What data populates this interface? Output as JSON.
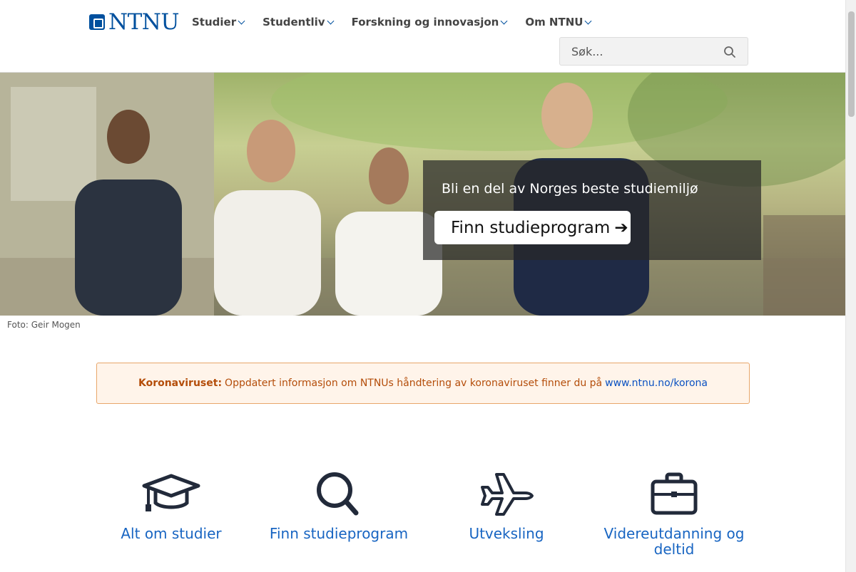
{
  "header": {
    "logo_text": "NTNU",
    "nav": [
      {
        "label": "Studier"
      },
      {
        "label": "Studentliv"
      },
      {
        "label": "Forskning og innovasjon"
      },
      {
        "label": "Om NTNU"
      }
    ],
    "search": {
      "placeholder": "Søk..."
    }
  },
  "hero": {
    "tagline": "Bli en del av Norges beste studiemiljø",
    "button_label": "Finn studieprogram",
    "caption": "Foto: Geir Mogen"
  },
  "alert": {
    "label": "Koronaviruset:",
    "text": "Oppdatert informasjon om NTNUs håndtering av koronaviruset finner du på",
    "link": "www.ntnu.no/korona"
  },
  "tiles": [
    {
      "label": "Alt om studier",
      "icon": "graduation-cap-icon"
    },
    {
      "label": "Finn studieprogram",
      "icon": "search-icon"
    },
    {
      "label": "Utveksling",
      "icon": "airplane-icon"
    },
    {
      "label": "Videreutdanning og deltid",
      "icon": "briefcase-icon"
    }
  ],
  "colors": {
    "brand": "#00509e",
    "link": "#1865c2",
    "alert_bg": "#fff4ea",
    "alert_text": "#b44d0a"
  }
}
